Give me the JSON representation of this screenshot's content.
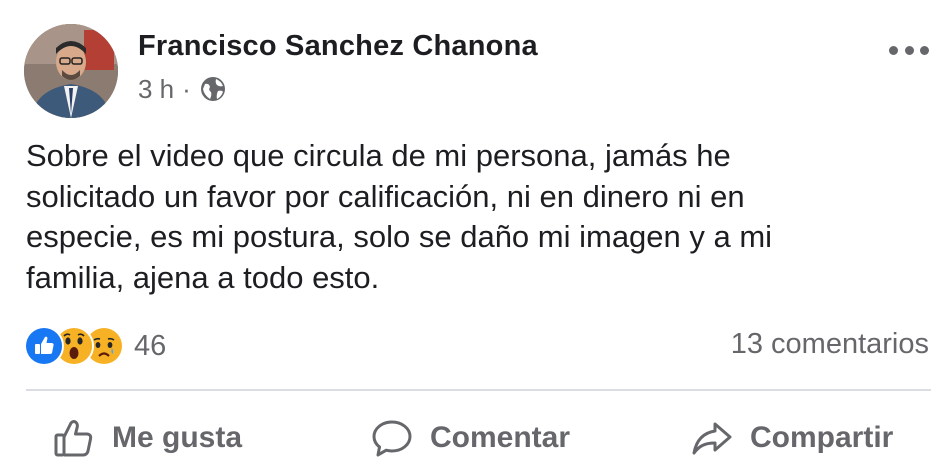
{
  "post": {
    "author": "Francisco Sanchez Chanona",
    "time": "3 h",
    "separator": "·",
    "privacy_icon": "globe-icon",
    "more_icon": "more-options-icon",
    "text": "Sobre el video que circula de mi persona, jamás he\nsolicitado un favor por calificación, ni en dinero ni en\nespecie, es mi postura, solo se daño mi imagen y a mi\nfamilia, ajena a todo esto."
  },
  "stats": {
    "reaction_icons": [
      "like-reaction-icon",
      "wow-reaction-icon",
      "sad-reaction-icon"
    ],
    "reaction_count": "46",
    "comments": "13 comentarios"
  },
  "actions": {
    "like": "Me gusta",
    "comment": "Comentar",
    "share": "Compartir"
  },
  "colors": {
    "text": "#1c1e21",
    "secondary": "#65676b",
    "like_blue": "#1877f2",
    "emoji_yellow": "#f7b125",
    "divider": "#dadde1"
  }
}
